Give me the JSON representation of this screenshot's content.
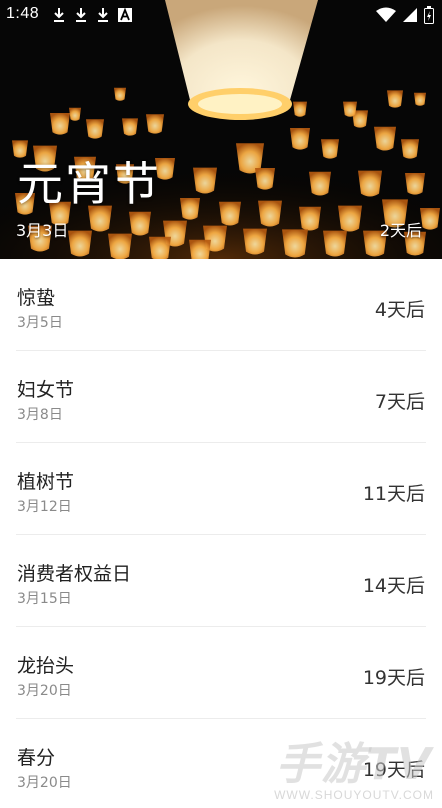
{
  "status_bar": {
    "time": "1:48",
    "left_icons": [
      "download-icon",
      "download-icon",
      "download-icon",
      "font-a-icon"
    ],
    "right_icons": [
      "wifi-icon",
      "signal-icon",
      "battery-charging-icon"
    ]
  },
  "hero": {
    "title": "元宵节",
    "date": "3月3日",
    "countdown": "2天后",
    "background": "sky-lanterns-night"
  },
  "holidays": [
    {
      "name": "惊蛰",
      "date": "3月5日",
      "countdown": "4天后"
    },
    {
      "name": "妇女节",
      "date": "3月8日",
      "countdown": "7天后"
    },
    {
      "name": "植树节",
      "date": "3月12日",
      "countdown": "11天后"
    },
    {
      "name": "消费者权益日",
      "date": "3月15日",
      "countdown": "14天后"
    },
    {
      "name": "龙抬头",
      "date": "3月20日",
      "countdown": "19天后"
    },
    {
      "name": "春分",
      "date": "3月20日",
      "countdown": "19天后"
    }
  ],
  "watermark": {
    "main": "手游TV",
    "sub": "WWW.SHOUYOUTV.COM"
  },
  "colors": {
    "text_primary": "#222222",
    "text_secondary": "#8a8a8a",
    "divider": "#ececec",
    "lantern_glow": "#ffb347"
  }
}
